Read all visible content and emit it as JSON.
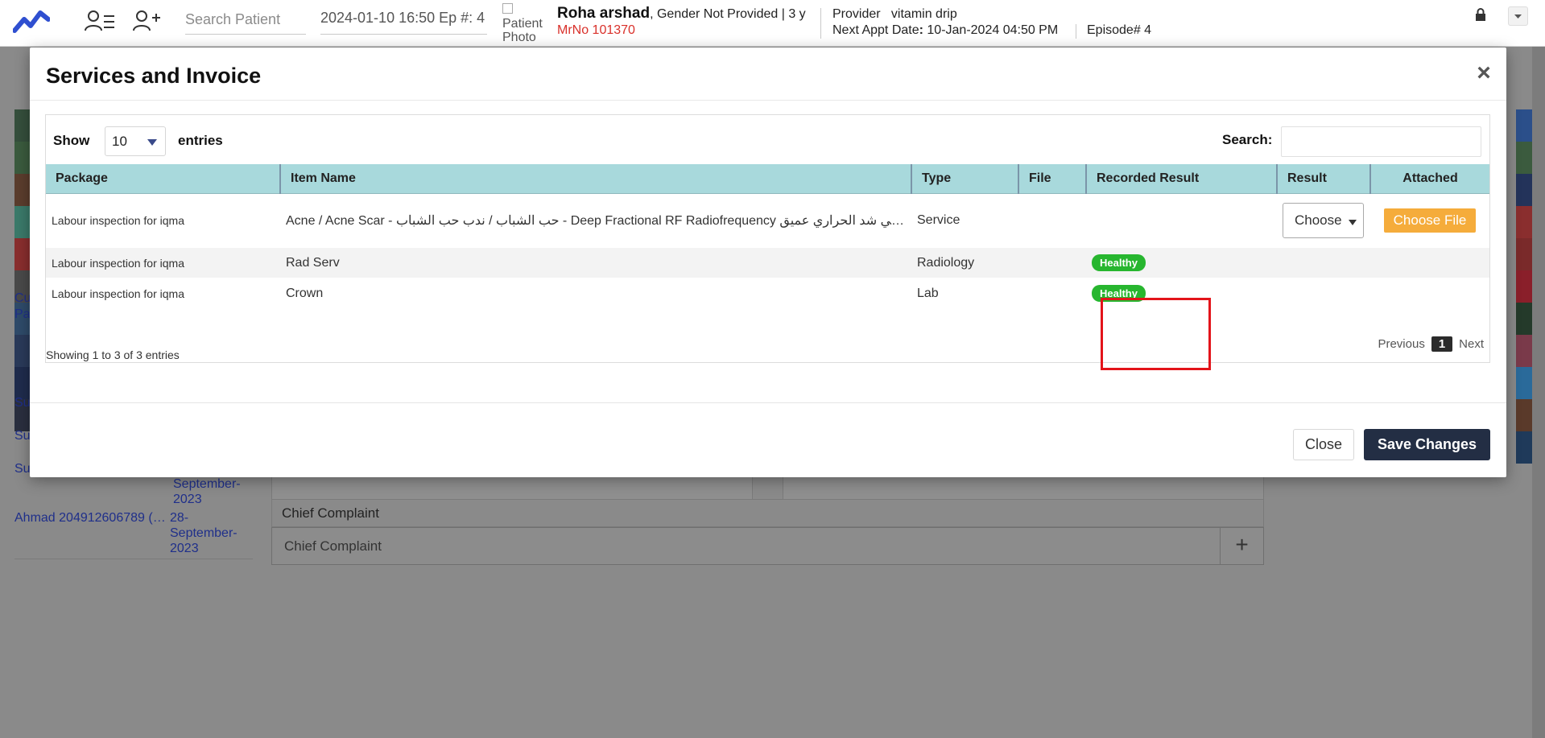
{
  "topbar": {
    "search_placeholder": "Search Patient",
    "datetime_episode": "2024-01-10 16:50 Ep #: 4",
    "patient_photo_alt": "Patient Photo",
    "patient_name": "Roha arshad",
    "patient_meta": ", Gender Not Provided | 3 y",
    "mrno": "MrNo 101370",
    "provider_label": "Provider",
    "provider_value": "vitamin drip",
    "next_appt_label": "Next Appt Date",
    "next_appt_sep": ": ",
    "next_appt_value": "10-Jan-2024 04:50 PM",
    "episode": "Episode# 4",
    "icons": [
      "chart-logo-icon",
      "user-list-icon",
      "add-user-icon",
      "lock-icon",
      "chevron-down-icon"
    ]
  },
  "background": {
    "links": [
      "Cu",
      "Pa",
      "Su",
      "Su",
      "Su",
      "Ahmad 204912606789 (…"
    ],
    "dates": [
      "September-",
      "2023",
      "28-",
      "September-",
      "2023"
    ],
    "chief_complaint_header": "Chief Complaint",
    "chief_complaint_placeholder": "Chief Complaint",
    "plus_icon": "+"
  },
  "modal": {
    "title": "Services and Invoice",
    "close_icon": "×",
    "show_label": "Show",
    "page_size": "10",
    "entries_label": "entries",
    "search_label": "Search:",
    "columns": [
      "Package",
      "Item Name",
      "Type",
      "File",
      "Recorded Result",
      "Result",
      "Attached"
    ],
    "rows": [
      {
        "package": "Labour inspection for iqma",
        "item": "Acne / Acne Scar - حب الشباب / ندب حب الشباب - Deep Fractional RF Radiofrequency راديو فريكونسي شد الحراري عميق...",
        "type": "Service",
        "file": "",
        "recorded_result": "",
        "result_select": "Choose",
        "attached_button": "Choose File"
      },
      {
        "package": "Labour inspection for iqma",
        "item": "Rad Serv",
        "type": "Radiology",
        "file": "",
        "recorded_result": "Healthy"
      },
      {
        "package": "Labour inspection for iqma",
        "item": "Crown",
        "type": "Lab",
        "file": "",
        "recorded_result": "Healthy"
      }
    ],
    "showing_text": "Showing 1 to 3 of 3 entries",
    "pager": {
      "previous": "Previous",
      "current": "1",
      "next": "Next"
    },
    "footer": {
      "close": "Close",
      "save": "Save Changes"
    }
  },
  "colors": {
    "header_row": "#a8d9dc",
    "badge": "#27b62f",
    "file_button": "#f5ac3b",
    "save_button": "#232e44",
    "mrno": "#d9302a",
    "highlight_box": "#e3141a"
  }
}
